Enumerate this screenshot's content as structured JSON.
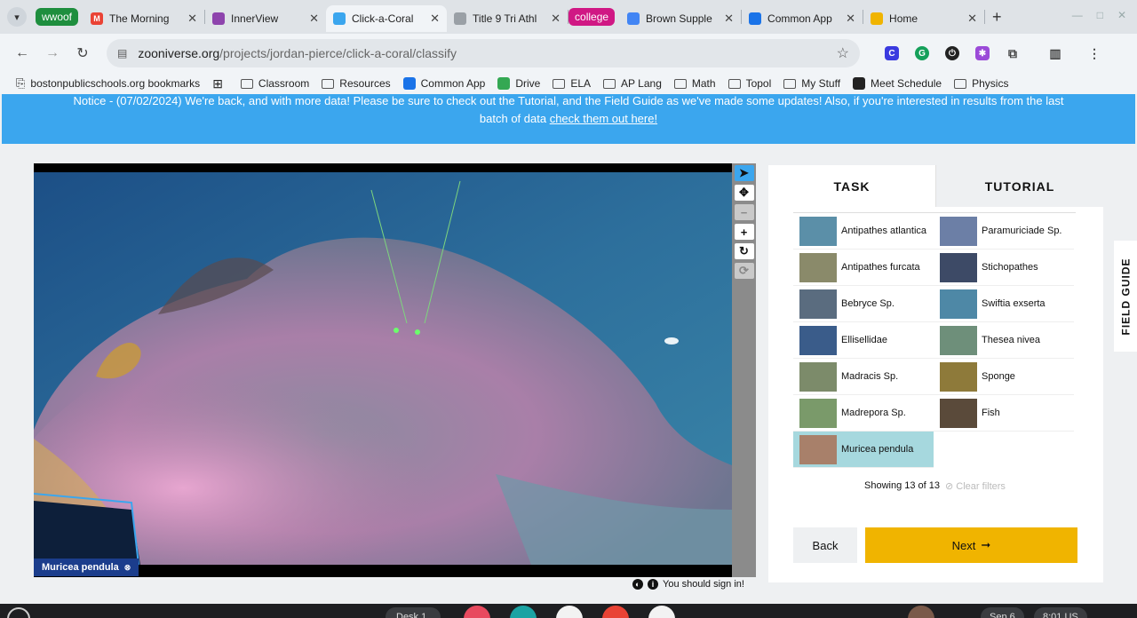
{
  "tabs": [
    {
      "group": "wwoof",
      "group_color": "#1e8e3e",
      "title": "The Morning",
      "fav": "M",
      "fav_color": "#ea4335"
    },
    {
      "title": "InnerView",
      "fav": "",
      "fav_color": "#8e44ad"
    },
    {
      "title": "Click-a-Coral",
      "fav": "",
      "fav_color": "#3ba6ee",
      "active": true
    },
    {
      "title": "Title 9 Tri Athl",
      "fav": "",
      "fav_color": "#9aa0a6"
    },
    {
      "group": "college",
      "group_color": "#d01884",
      "title": "Brown Supple",
      "fav": "",
      "fav_color": "#4285f4"
    },
    {
      "title": "Common App",
      "fav": "",
      "fav_color": "#1a73e8"
    },
    {
      "title": "Home",
      "fav": "",
      "fav_color": "#f0b400"
    }
  ],
  "toolbar": {
    "url_host": "zooniverse.org",
    "url_path": "/projects/jordan-pierce/click-a-coral/classify"
  },
  "bookmarks": [
    {
      "label": "bostonpublicschools.org bookmarks",
      "type": "import"
    },
    {
      "label": "",
      "type": "apps"
    },
    {
      "label": "Classroom",
      "type": "folder"
    },
    {
      "label": "Resources",
      "type": "folder"
    },
    {
      "label": "Common App",
      "type": "site",
      "color": "#1a73e8"
    },
    {
      "label": "Drive",
      "type": "site",
      "color": "#34a853"
    },
    {
      "label": "ELA",
      "type": "folder"
    },
    {
      "label": "AP Lang",
      "type": "folder"
    },
    {
      "label": "Math",
      "type": "folder"
    },
    {
      "label": "Topol",
      "type": "folder"
    },
    {
      "label": "My Stuff",
      "type": "folder"
    },
    {
      "label": "Meet Schedule",
      "type": "site",
      "color": "#222"
    },
    {
      "label": "Physics",
      "type": "folder"
    }
  ],
  "notice": {
    "line1": "Notice - (07/02/2024) We're back, and with more data! Please be sure to check out the Tutorial, and the Field Guide as we've made some updates! Also, if you're interested in results from the last",
    "line2_prefix": "batch of data ",
    "link": "check them out here!"
  },
  "viewer": {
    "annotation_label": "Muricea pendula"
  },
  "panel": {
    "tab_task": "TASK",
    "tab_tutorial": "TUTORIAL",
    "species": [
      {
        "name": "Antipathes atlantica",
        "thumb": "#5b8fa8"
      },
      {
        "name": "Paramuriciade Sp.",
        "thumb": "#6c7fa6"
      },
      {
        "name": "Antipathes furcata",
        "thumb": "#8a8a6a"
      },
      {
        "name": "Stichopathes",
        "thumb": "#3d4a66"
      },
      {
        "name": "Bebryce Sp.",
        "thumb": "#5a6c7f"
      },
      {
        "name": "Swiftia exserta",
        "thumb": "#4e88a6"
      },
      {
        "name": "Ellisellidae",
        "thumb": "#3a5c8a"
      },
      {
        "name": "Thesea nivea",
        "thumb": "#6e8f7a"
      },
      {
        "name": "Madracis Sp.",
        "thumb": "#7c8b6a"
      },
      {
        "name": "Sponge",
        "thumb": "#8e7a3a"
      },
      {
        "name": "Madrepora Sp.",
        "thumb": "#7a9a6a"
      },
      {
        "name": "Fish",
        "thumb": "#5a4a3a"
      },
      {
        "name": "Muricea pendula",
        "thumb": "#a8806a",
        "selected": true
      }
    ],
    "showing": "Showing 13 of 13",
    "clear_filters": "Clear filters",
    "back": "Back",
    "next": "Next"
  },
  "field_guide": "FIELD GUIDE",
  "signin": "You should sign in!",
  "shelf": {
    "desk": "Desk 1",
    "date": "Sep 6",
    "time": "8:01 US"
  }
}
